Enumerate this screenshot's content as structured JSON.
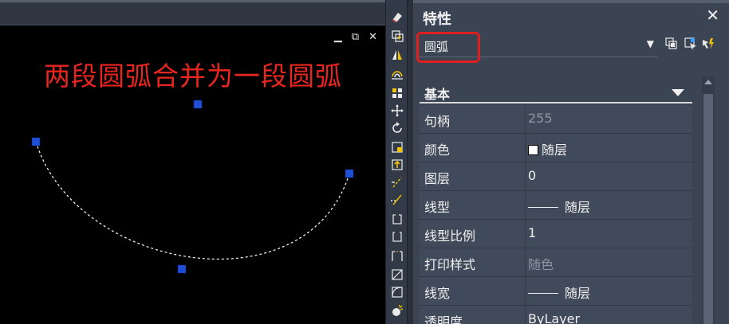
{
  "canvas": {
    "annotation": "两段圆弧合并为一段圆弧",
    "window_controls": {
      "minimize": "▁",
      "restore": "⧉",
      "close": "✕"
    }
  },
  "toolbar": {
    "tools": [
      "eraser-icon",
      "copy-icon",
      "mirror-icon",
      "offset-icon",
      "array-icon",
      "move-icon",
      "rotate-icon",
      "scale-icon",
      "stretch-icon",
      "trim-icon",
      "extend-icon",
      "break-at-point-icon",
      "break-icon",
      "join-icon",
      "chamfer-icon",
      "fillet-icon",
      "explode-icon"
    ]
  },
  "panel": {
    "title": "特性",
    "close_label": "✕",
    "selected_object": "圆弧",
    "section": "基本",
    "properties": [
      {
        "name": "句柄",
        "value": "255",
        "dim": true
      },
      {
        "name": "颜色",
        "value": "随层",
        "swatch": true
      },
      {
        "name": "图层",
        "value": "0"
      },
      {
        "name": "线型",
        "value": "随层",
        "dash": true
      },
      {
        "name": "线型比例",
        "value": "1"
      },
      {
        "name": "打印样式",
        "value": "随色",
        "dim": true
      },
      {
        "name": "线宽",
        "value": "随层",
        "dash": true
      },
      {
        "name": "透明度",
        "value": "ByLayer"
      }
    ]
  },
  "colors": {
    "annotation": "#e8261f",
    "highlight_box": "#e02020",
    "grip": "#1e4fd8",
    "panel_bg": "#3b4453"
  }
}
